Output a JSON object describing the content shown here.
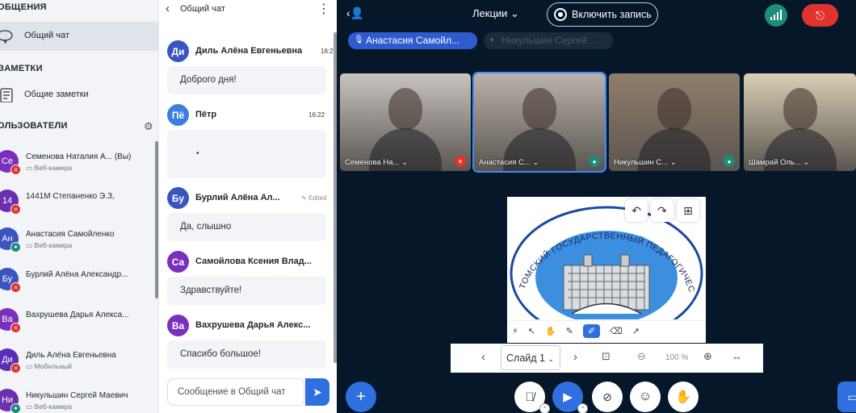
{
  "left": {
    "messages_header": "ОБЩЕНИЯ",
    "general_chat": "Общий чат",
    "notes_header": "ЗАМЕТКИ",
    "shared_notes": "Общие заметки",
    "users_header": "ОЛЬЗОВАТЕЛИ",
    "users": [
      {
        "initials": "Се",
        "color": "#7b2fbf",
        "mic": "muted",
        "name": "Семенова Наталия А... (Вы)",
        "sub": "Веб-камера"
      },
      {
        "initials": "14",
        "color": "#6b2fb0",
        "mic": "muted",
        "name": "1441М Степаненко Э.З,",
        "sub": ""
      },
      {
        "initials": "Ан",
        "color": "#3b55c0",
        "mic": "on",
        "name": "Анастасия Самойленко",
        "sub": "Веб-камера"
      },
      {
        "initials": "Бу",
        "color": "#3b55c0",
        "mic": "muted",
        "name": "Бурлий Алёна Александр...",
        "sub": ""
      },
      {
        "initials": "Ва",
        "color": "#7b2fbf",
        "mic": "muted",
        "name": "Вахрушева Дарья Алекса...",
        "sub": ""
      },
      {
        "initials": "Ди",
        "color": "#5a2fb8",
        "mic": "muted",
        "name": "Диль Алёна Евгеньевна",
        "sub": "Мобильный"
      },
      {
        "initials": "Ни",
        "color": "#6b2fb0",
        "mic": "on",
        "name": "Никульшин Сергей Маевич",
        "sub": "Веб-камера"
      }
    ]
  },
  "chat": {
    "title": "Общий чат",
    "messages": [
      {
        "initials": "Ди",
        "color": "#3b55c0",
        "name": "Диль Алёна Евгеньевна",
        "time": "16:2",
        "edited": "",
        "text": "Доброго дня!"
      },
      {
        "initials": "Пё",
        "color": "#3d7fe0",
        "name": "Пётр",
        "time": "16:22",
        "edited": "",
        "text": "•"
      },
      {
        "initials": "Бу",
        "color": "#3b55c0",
        "name": "Бурлий Алёна Ал...",
        "time": "",
        "edited": "Edited",
        "text": "Да, слышно"
      },
      {
        "initials": "Са",
        "color": "#7b2fbf",
        "name": "Самойлова Ксения Влад...",
        "time": "",
        "edited": "",
        "text": "Здравствуйте!"
      },
      {
        "initials": "Ва",
        "color": "#7b2fbf",
        "name": "Вахрушева Дарья Алекс...",
        "time": "",
        "edited": "",
        "text": "Спасибо большое!"
      }
    ],
    "input_placeholder": "Сообщение в Общий чат"
  },
  "main": {
    "room_name": "Лекции",
    "record_label": "Включить запись",
    "talkers": [
      {
        "name": "Анастасия Самойл...",
        "active": true
      },
      {
        "name": "Никульшин Сергей ...",
        "active": false
      }
    ],
    "tiles": [
      {
        "name": "Семенова На...",
        "mic": "muted",
        "bg": "#c9c4bf"
      },
      {
        "name": "Анастасия С...",
        "mic": "on",
        "bg": "#b9b2aa"
      },
      {
        "name": "Никульшин С...",
        "mic": "on",
        "bg": "#8f7e6c"
      },
      {
        "name": "Шамрай Оль...",
        "mic": "",
        "bg": "#d9cfb5"
      }
    ],
    "slide": {
      "university": "ТОМСКИЙ ГОСУДАРСТВЕННЫЙ ПЕДАГОГИЧЕСКИЙ УНИВЕРСИТЕТ"
    },
    "slide_label": "Слайд 1",
    "zoom": "100 %"
  },
  "colors": {
    "accent": "#2f6fe0",
    "danger": "#e0332e",
    "signal": "#1d8c7a",
    "bg": "#06172a"
  }
}
